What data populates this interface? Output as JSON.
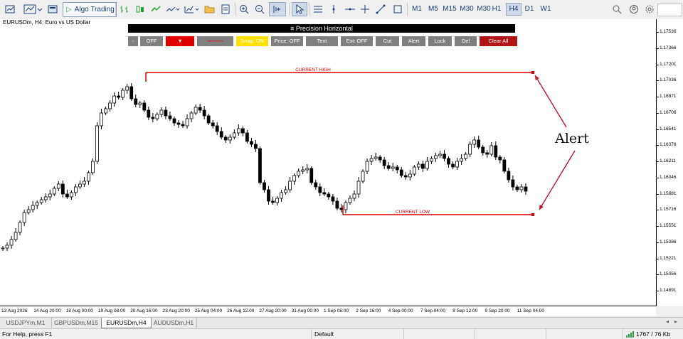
{
  "toolbar": {
    "algo_label": "Algo Trading",
    "timeframes": [
      "M1",
      "M5",
      "M15",
      "M30",
      "H1",
      "H4",
      "D1",
      "W1"
    ],
    "active_timeframe": "H4"
  },
  "chart": {
    "symbol_title": "EURUSDm, H4:  Euro vs US Dollar",
    "high_label": "CURRENT HIGH",
    "low_label": "CURRENT LOW",
    "annotation": "Alert",
    "line_color": "#e00000",
    "arrow_color": "#c8102e",
    "bull_color": "#ffffff",
    "bear_color": "#000000"
  },
  "panel": {
    "title": "≡ Precision Horizontal",
    "buttons": [
      {
        "label": "-",
        "bg": "#7f7f7f",
        "fg": "#ffffff"
      },
      {
        "label": "OFF",
        "bg": "#7f7f7f",
        "fg": "#ffffff"
      },
      {
        "label": "▼",
        "bg": "#e00000",
        "fg": "#ffffff"
      },
      {
        "label": "———",
        "bg": "#7f7f7f",
        "fg": "#e00000"
      },
      {
        "label": "Snap: ON",
        "bg": "#ffe000",
        "fg": "#ffffff"
      },
      {
        "label": "Price: OFF",
        "bg": "#7f7f7f",
        "fg": "#ffffff"
      },
      {
        "label": "Text",
        "bg": "#7f7f7f",
        "fg": "#ffffff"
      },
      {
        "label": "Ext: OFF",
        "bg": "#7f7f7f",
        "fg": "#ffffff"
      },
      {
        "label": "Cut",
        "bg": "#7f7f7f",
        "fg": "#ffffff"
      },
      {
        "label": "Alert",
        "bg": "#7f7f7f",
        "fg": "#ffffff"
      },
      {
        "label": "Lock",
        "bg": "#7f7f7f",
        "fg": "#ffffff"
      },
      {
        "label": "Del",
        "bg": "#7f7f7f",
        "fg": "#ffffff"
      },
      {
        "label": "Clear All",
        "bg": "#b01414",
        "fg": "#ffffff"
      }
    ]
  },
  "price_axis": [
    "1.17536",
    "1.17366",
    "1.17201",
    "1.17036",
    "1.16871",
    "1.16706",
    "1.16541",
    "1.16376",
    "1.16211",
    "1.16046",
    "1.15881",
    "1.15716",
    "1.15551",
    "1.15386",
    "1.15221",
    "1.15056",
    "1.14891"
  ],
  "time_axis": [
    "13 Aug 2026",
    "14 Aug 20:00",
    "18 Aug 00:00",
    "19 Aug 08:00",
    "20 Aug 16:00",
    "23 Aug 20:00",
    "25 Aug 04:00",
    "26 Aug 12:00",
    "27 Aug 20:00",
    "31 Aug 00:00",
    "1 Sep 08:00",
    "2 Sep 16:00",
    "4 Sep 00:00",
    "7 Sep 04:00",
    "8 Sep 12:00",
    "9 Sep 20:00",
    "11 Sep 04:00"
  ],
  "tabs": [
    "USDJPYm,M1",
    "GBPUSDm,M15",
    "EURUSDm,H4",
    "AUDUSDm,H1"
  ],
  "active_tab": "EURUSDm,H4",
  "status": {
    "help": "For Help, press F1",
    "profile": "Default",
    "traffic": "1767 / 76 Kb"
  }
}
